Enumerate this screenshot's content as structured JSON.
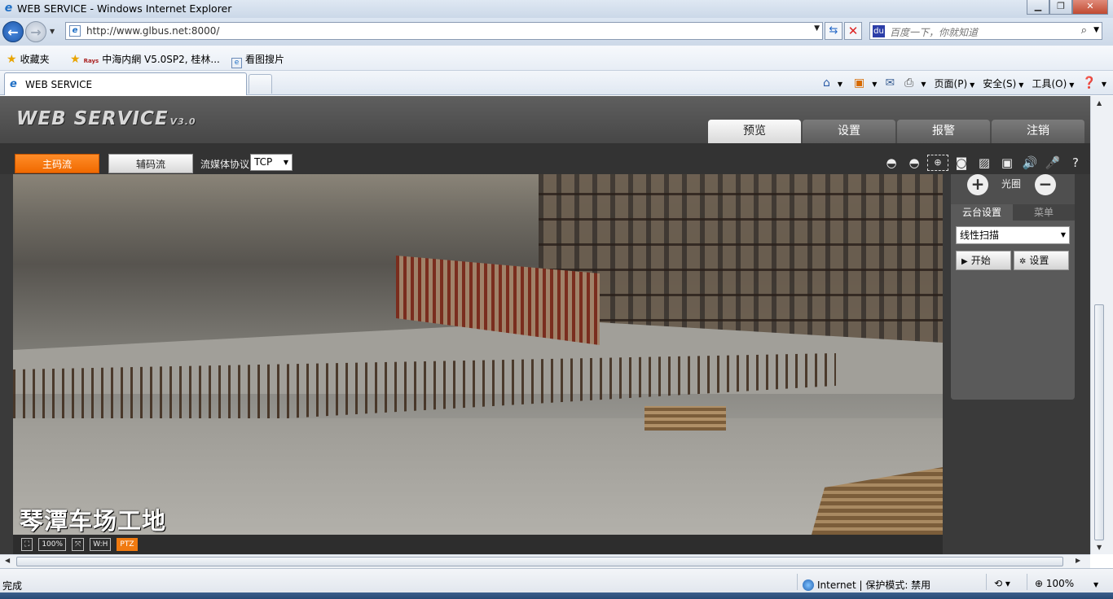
{
  "browser": {
    "window_title": "WEB SERVICE - Windows Internet Explorer",
    "address_url": "http://www.glbus.net:8000/",
    "search_placeholder": "百度一下，你就知道",
    "favorites": {
      "label": "收藏夹",
      "items": [
        "中海内網 V5.0SP2, 桂林...",
        "看图搜片"
      ]
    },
    "tab_title": "WEB SERVICE",
    "command_bar": {
      "page": "页面(P)",
      "safety": "安全(S)",
      "tools": "工具(O)"
    },
    "status": {
      "left": "完成",
      "zone": "Internet | 保护模式: 禁用",
      "zoom": "100%"
    }
  },
  "app": {
    "logo": "WEB  SERVICE",
    "logo_version": "V3.0",
    "nav_tabs": [
      "预览",
      "设置",
      "报警",
      "注销"
    ],
    "active_tab": "预览",
    "toolbar": {
      "main_stream": "主码流",
      "sub_stream": "辅码流",
      "protocol_label": "流媒体协议",
      "protocol_value": "TCP"
    },
    "video": {
      "osd_text": "琴潭车场工地"
    },
    "video_controls": [
      "100%",
      "W:H",
      "PTZ"
    ],
    "ptz": {
      "iris_label": "光圈",
      "tabs": [
        "云台设置",
        "菜单"
      ],
      "mode_value": "线性扫描",
      "start_button": "开始",
      "settings_button": "设置"
    },
    "colors": {
      "accent_orange": "#f07a10",
      "header_gray": "#5f5f5f"
    }
  }
}
